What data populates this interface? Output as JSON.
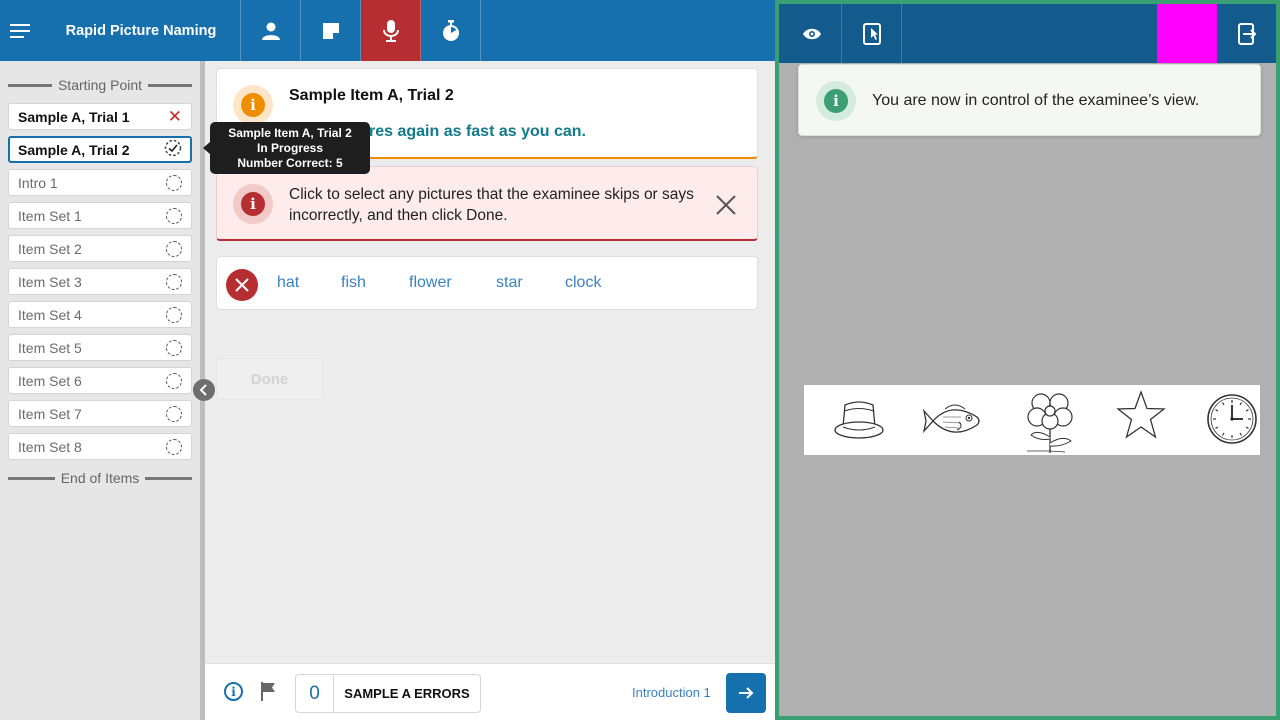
{
  "header": {
    "title": "Rapid Picture Naming",
    "toolbar": [
      "menu-icon",
      "person-icon",
      "note-icon",
      "microphone-icon",
      "timer-icon"
    ],
    "active_tool": "microphone-icon",
    "colors": {
      "bar": "#1670ad",
      "active": "#b62d32"
    }
  },
  "sidebar": {
    "starting_point": "Starting Point",
    "end_label": "End of Items",
    "items": [
      {
        "label": "Sample A, Trial 1",
        "status": "incorrect"
      },
      {
        "label": "Sample A, Trial 2",
        "status": "in-progress",
        "selected": true
      },
      {
        "label": "Intro 1",
        "status": "not-started"
      },
      {
        "label": "Item Set 1",
        "status": "not-started"
      },
      {
        "label": "Item Set 2",
        "status": "not-started"
      },
      {
        "label": "Item Set 3",
        "status": "not-started"
      },
      {
        "label": "Item Set 4",
        "status": "not-started"
      },
      {
        "label": "Item Set 5",
        "status": "not-started"
      },
      {
        "label": "Item Set 6",
        "status": "not-started"
      },
      {
        "label": "Item Set 7",
        "status": "not-started"
      },
      {
        "label": "Item Set 8",
        "status": "not-started"
      }
    ]
  },
  "tooltip": {
    "line1": "Sample Item A, Trial 2",
    "line2": "In Progress",
    "line3": "Number Correct: 5"
  },
  "main": {
    "info_card": {
      "title": "Sample Item A, Trial 2",
      "instruction": "ll the pictures again as fast as you can."
    },
    "alert_card": {
      "text": "Click to select any pictures that the examinee skips or says incorrectly, and then click Done."
    },
    "words": [
      "hat",
      "fish",
      "flower",
      "star",
      "clock"
    ],
    "done_label": "Done"
  },
  "footer": {
    "error_count": "0",
    "error_label": "SAMPLE A ERRORS",
    "next_label": "Introduction 1"
  },
  "right_panel": {
    "toolbar": [
      "eye-icon",
      "tablet-touch-icon",
      "exit-icon"
    ],
    "notice": "You are now in control of the examinee’s view.",
    "pictures": [
      "hat",
      "fish",
      "flower",
      "star",
      "clock"
    ],
    "colors": {
      "border": "#3aa073",
      "bar": "#135b8c",
      "highlight": "#ff00ff"
    }
  }
}
